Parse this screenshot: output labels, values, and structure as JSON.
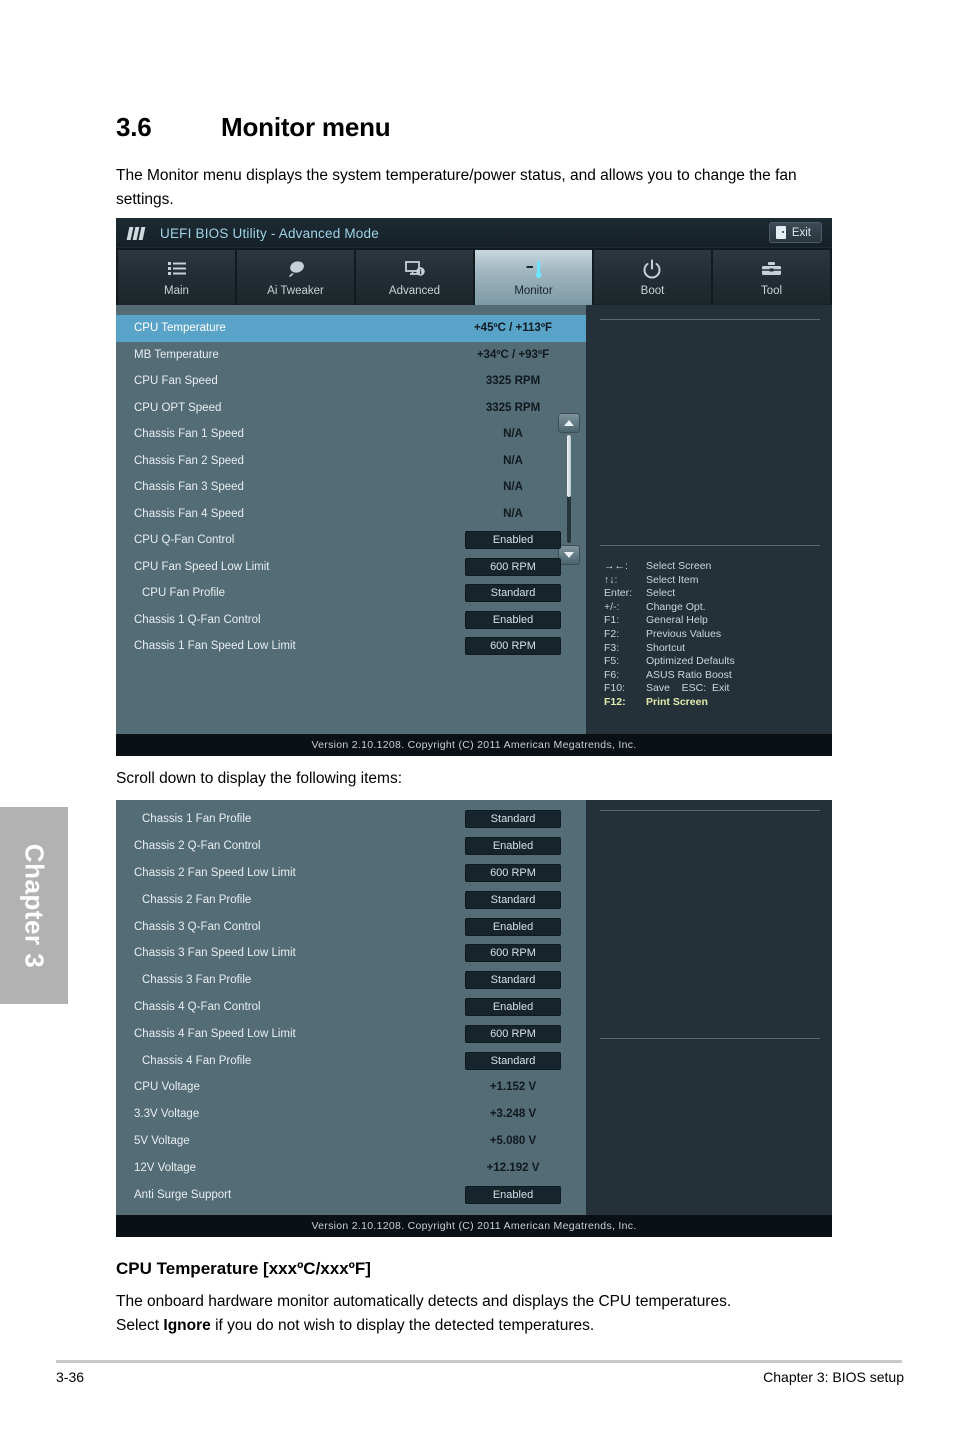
{
  "document": {
    "section_number": "3.6",
    "section_title": "Monitor menu",
    "intro": "The Monitor menu displays the system temperature/power status, and allows you to change the fan settings.",
    "scroll_note": "Scroll down to display the following items:",
    "subsection_title": "CPU Temperature [xxxºC/xxxºF]",
    "body_line1": "The onboard hardware monitor automatically detects and displays the CPU temperatures.",
    "body_line2_pre": "Select ",
    "body_line2_bold": "Ignore",
    "body_line2_post": " if you do not wish to display the detected temperatures.",
    "chapter_tab": "Chapter 3",
    "footer_left": "3-36",
    "footer_right": "Chapter 3: BIOS setup"
  },
  "bios": {
    "logo": "ASUS",
    "title": "UEFI BIOS Utility - Advanced Mode",
    "exit_label": "Exit",
    "version_line": "Version  2.10.1208.   Copyright  (C)  2011  American  Megatrends,  Inc.",
    "nav_tabs": [
      {
        "label": "Main",
        "icon": "list-icon",
        "active": false
      },
      {
        "label": "Ai  Tweaker",
        "icon": "tuner-knob-icon",
        "active": false
      },
      {
        "label": "Advanced",
        "icon": "monitor-info-icon",
        "active": false
      },
      {
        "label": "Monitor",
        "icon": "thermometer-icon",
        "active": true
      },
      {
        "label": "Boot",
        "icon": "power-icon",
        "active": false
      },
      {
        "label": "Tool",
        "icon": "toolbox-icon",
        "active": false
      }
    ],
    "help_keys": [
      {
        "key": "→←:",
        "desc": "Select Screen",
        "highlight": false
      },
      {
        "key": "↑↓:",
        "desc": "Select Item",
        "highlight": false
      },
      {
        "key": "Enter:",
        "desc": "Select",
        "highlight": false
      },
      {
        "key": "+/-:",
        "desc": "Change Opt.",
        "highlight": false
      },
      {
        "key": "F1:",
        "desc": "General Help",
        "highlight": false
      },
      {
        "key": "F2:",
        "desc": "Previous Values",
        "highlight": false
      },
      {
        "key": "F3:",
        "desc": "Shortcut",
        "highlight": false
      },
      {
        "key": "F5:",
        "desc": "Optimized Defaults",
        "highlight": false
      },
      {
        "key": "F6:",
        "desc": "ASUS Ratio Boost",
        "highlight": false
      },
      {
        "key": "F10:",
        "desc": "Save    ESC:  Exit",
        "highlight": false
      },
      {
        "key": "F12:",
        "desc": "Print Screen",
        "highlight": true
      }
    ],
    "screen1_rows": [
      {
        "label": "CPU Temperature",
        "value": "+45ºC / +113ºF",
        "type": "text",
        "selected": true,
        "indent": false
      },
      {
        "label": "MB Temperature",
        "value": "+34ºC / +93ºF",
        "type": "text",
        "selected": false,
        "indent": false
      },
      {
        "label": "CPU Fan Speed",
        "value": "3325 RPM",
        "type": "text",
        "selected": false,
        "indent": false
      },
      {
        "label": "CPU OPT Speed",
        "value": "3325 RPM",
        "type": "text",
        "selected": false,
        "indent": false
      },
      {
        "label": "Chassis Fan 1 Speed",
        "value": "N/A",
        "type": "text",
        "selected": false,
        "indent": false
      },
      {
        "label": "Chassis Fan 2 Speed",
        "value": "N/A",
        "type": "text",
        "selected": false,
        "indent": false
      },
      {
        "label": "Chassis Fan 3 Speed",
        "value": "N/A",
        "type": "text",
        "selected": false,
        "indent": false
      },
      {
        "label": "Chassis Fan 4 Speed",
        "value": "N/A",
        "type": "text",
        "selected": false,
        "indent": false
      },
      {
        "label": "CPU Q-Fan Control",
        "value": "Enabled",
        "type": "button",
        "selected": false,
        "indent": false
      },
      {
        "label": "CPU Fan Speed Low Limit",
        "value": "600 RPM",
        "type": "button",
        "selected": false,
        "indent": false
      },
      {
        "label": "CPU Fan Profile",
        "value": "Standard",
        "type": "button",
        "selected": false,
        "indent": true
      },
      {
        "label": "Chassis 1 Q-Fan Control",
        "value": "Enabled",
        "type": "button",
        "selected": false,
        "indent": false
      },
      {
        "label": "Chassis 1 Fan Speed Low Limit",
        "value": "600 RPM",
        "type": "button",
        "selected": false,
        "indent": false
      }
    ],
    "screen2_rows": [
      {
        "label": "Chassis 1 Fan Profile",
        "value": "Standard",
        "type": "button",
        "selected": false,
        "indent": true
      },
      {
        "label": "Chassis 2 Q-Fan Control",
        "value": "Enabled",
        "type": "button",
        "selected": false,
        "indent": false
      },
      {
        "label": "Chassis 2 Fan Speed Low Limit",
        "value": "600 RPM",
        "type": "button",
        "selected": false,
        "indent": false
      },
      {
        "label": "Chassis 2 Fan Profile",
        "value": "Standard",
        "type": "button",
        "selected": false,
        "indent": true
      },
      {
        "label": "Chassis 3 Q-Fan Control",
        "value": "Enabled",
        "type": "button",
        "selected": false,
        "indent": false
      },
      {
        "label": "Chassis 3 Fan Speed Low Limit",
        "value": "600 RPM",
        "type": "button",
        "selected": false,
        "indent": false
      },
      {
        "label": "Chassis 3 Fan Profile",
        "value": "Standard",
        "type": "button",
        "selected": false,
        "indent": true
      },
      {
        "label": "Chassis 4 Q-Fan Control",
        "value": "Enabled",
        "type": "button",
        "selected": false,
        "indent": false
      },
      {
        "label": "Chassis 4 Fan Speed Low Limit",
        "value": "600 RPM",
        "type": "button",
        "selected": false,
        "indent": false
      },
      {
        "label": "Chassis 4 Fan Profile",
        "value": "Standard",
        "type": "button",
        "selected": false,
        "indent": true
      },
      {
        "label": "CPU Voltage",
        "value": "+1.152 V",
        "type": "text",
        "selected": false,
        "indent": false
      },
      {
        "label": "3.3V Voltage",
        "value": "+3.248 V",
        "type": "text",
        "selected": false,
        "indent": false
      },
      {
        "label": "5V Voltage",
        "value": "+5.080 V",
        "type": "text",
        "selected": false,
        "indent": false
      },
      {
        "label": "12V Voltage",
        "value": "+12.192 V",
        "type": "text",
        "selected": false,
        "indent": false
      },
      {
        "label": "Anti Surge Support",
        "value": "Enabled",
        "type": "button",
        "selected": false,
        "indent": false
      }
    ],
    "colors": {
      "accent_highlight": "#5aa3c8",
      "list_background": "#546c76",
      "help_background": "#243139",
      "title_text": "#9fd3e8",
      "hotkey_highlight": "#e3eaad"
    }
  }
}
